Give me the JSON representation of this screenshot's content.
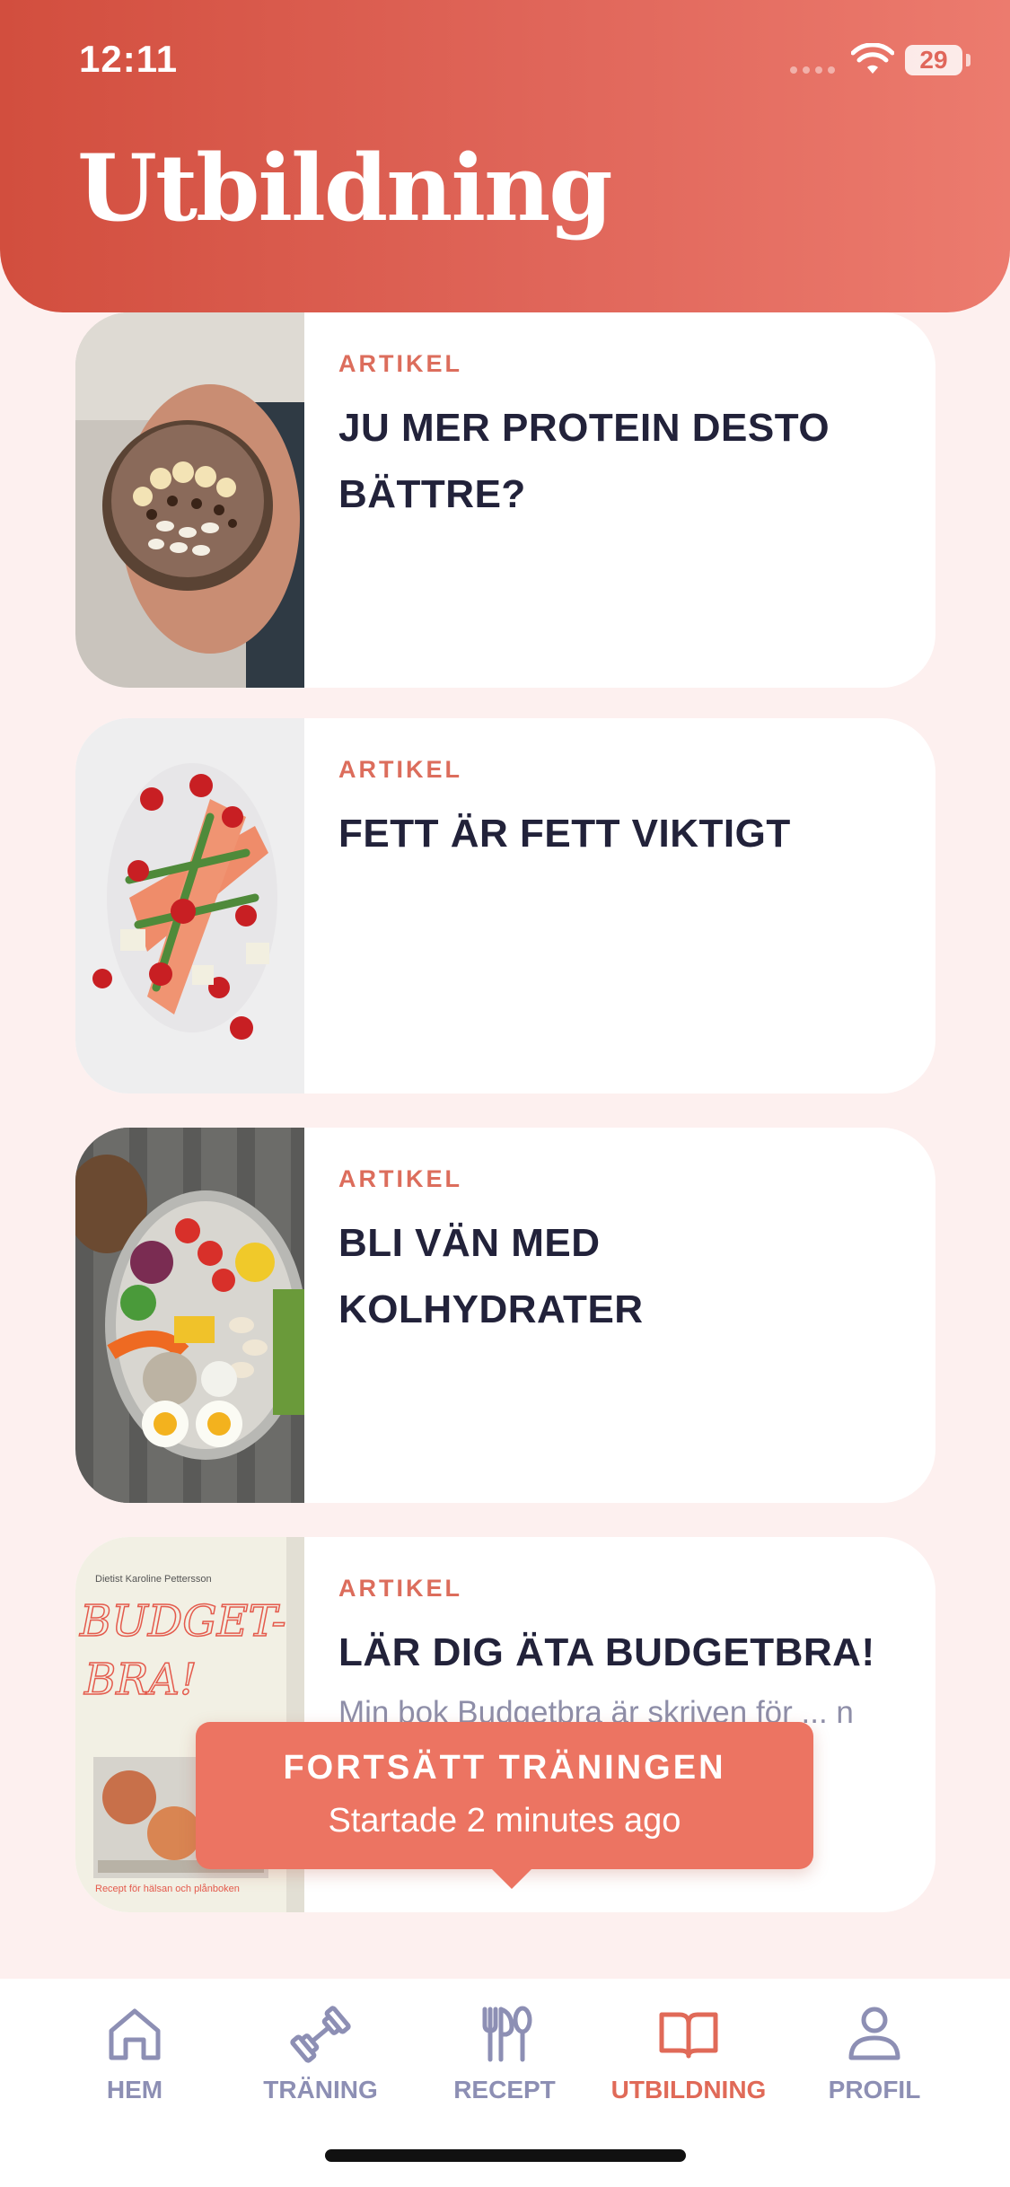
{
  "status_bar": {
    "time": "12:11",
    "battery": "29"
  },
  "page": {
    "title": "Utbildning"
  },
  "articles": [
    {
      "label": "ARTIKEL",
      "title": "JU MER PROTEIN DESTO BÄTTRE?",
      "description": ""
    },
    {
      "label": "ARTIKEL",
      "title": "FETT ÄR FETT VIKTIGT",
      "description": ""
    },
    {
      "label": "ARTIKEL",
      "title": "BLI VÄN MED KOLHYDRATER",
      "description": ""
    },
    {
      "label": "ARTIKEL",
      "title": "LÄR DIG ÄTA BUDGETBRA!",
      "description": "Min bok Budgetbra är skriven för ... n at..."
    }
  ],
  "book_cover": {
    "author": "Dietist Karoline Pettersson",
    "title": "BUDGET-BRA!",
    "subtitle": "Recept för hälsan och plånboken"
  },
  "toast": {
    "title": "FORTSÄTT TRÄNINGEN",
    "subtitle": "Startade 2 minutes ago"
  },
  "tabs": [
    {
      "label": "HEM",
      "icon": "home-icon"
    },
    {
      "label": "TRÄNING",
      "icon": "dumbbell-icon"
    },
    {
      "label": "RECEPT",
      "icon": "fork-spoon-icon"
    },
    {
      "label": "UTBILDNING",
      "icon": "book-icon",
      "active": true
    },
    {
      "label": "PROFIL",
      "icon": "person-icon"
    }
  ],
  "colors": {
    "accent": "#e06a58",
    "header": "#d24e3e",
    "background": "#fdf0ef",
    "tab_inactive": "#8d8fb4"
  }
}
